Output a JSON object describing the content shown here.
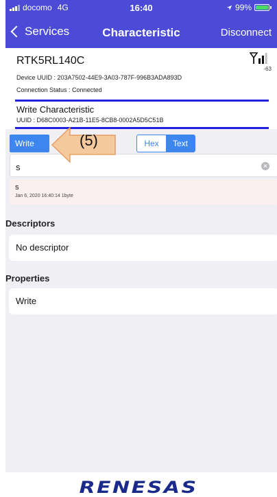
{
  "status_bar": {
    "carrier": "docomo",
    "network": "4G",
    "time": "16:40",
    "battery_percent": "99%",
    "battery_level": 0.99
  },
  "nav": {
    "back_label": "Services",
    "title": "Characteristic",
    "right_label": "Disconnect"
  },
  "device": {
    "name": "RTK5RL140C",
    "rssi": "-63",
    "uuid": "Device UUID : 203A7502-44E9-3A03-787F-996B3ADA893D",
    "connection_status": "Connection Status :  Connected"
  },
  "characteristic": {
    "title": "Write Characteristic",
    "uuid": "UUID : D68C0003-A21B-11E5-8CB8-0002A5D5C51B"
  },
  "controls": {
    "write_label": "Write",
    "format_options": [
      "Hex",
      "Text"
    ],
    "selected_format": "Text",
    "input_value": "s"
  },
  "log": {
    "value": "s",
    "meta": "Jan 6, 2020 16:40:14   1byte"
  },
  "descriptors": {
    "header": "Descriptors",
    "items": [
      "No descriptor"
    ]
  },
  "properties": {
    "header": "Properties",
    "items": [
      "Write"
    ]
  },
  "annotation": {
    "label": "(5)",
    "color": "#f6c79a"
  },
  "footer": {
    "logo_text": "RENESAS"
  },
  "colors": {
    "nav_bg": "#4b4bd8",
    "accent": "#3d86f0",
    "divider": "#2020e0"
  }
}
